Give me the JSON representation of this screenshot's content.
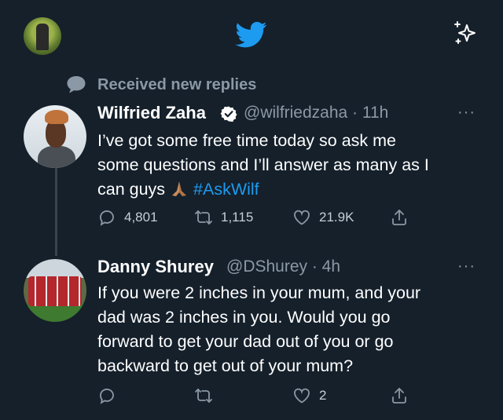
{
  "header": {
    "bird_icon": "twitter-bird-icon",
    "sparkle_icon": "sparkle-icon"
  },
  "notice": {
    "text": "Received new replies",
    "icon": "speech-bubble-icon"
  },
  "tweets": [
    {
      "name": "Wilfried Zaha",
      "verified": true,
      "handle_time": "@wilfriedzaha · 11h",
      "more": "···",
      "line1": "I’ve got some free time today so ask me",
      "line2": "some questions and I’ll answer as many as I",
      "line3_text": "can guys",
      "hashtag": "#AskWilf",
      "replies": "4,801",
      "retweets": "1,115",
      "likes": "21.9K"
    },
    {
      "name": "Danny Shurey",
      "handle_time": "@DShurey · 4h",
      "more": "···",
      "line1": "If you were 2 inches in your mum, and your",
      "line2": "dad was 2 inches in you. Would you go",
      "line3": "forward to get your dad out of you or go",
      "line4": "backward to get out of your mum?",
      "likes": "2"
    }
  ],
  "colors": {
    "background": "#15202b",
    "accent": "#1d9bf0",
    "muted": "#8b98a5"
  }
}
